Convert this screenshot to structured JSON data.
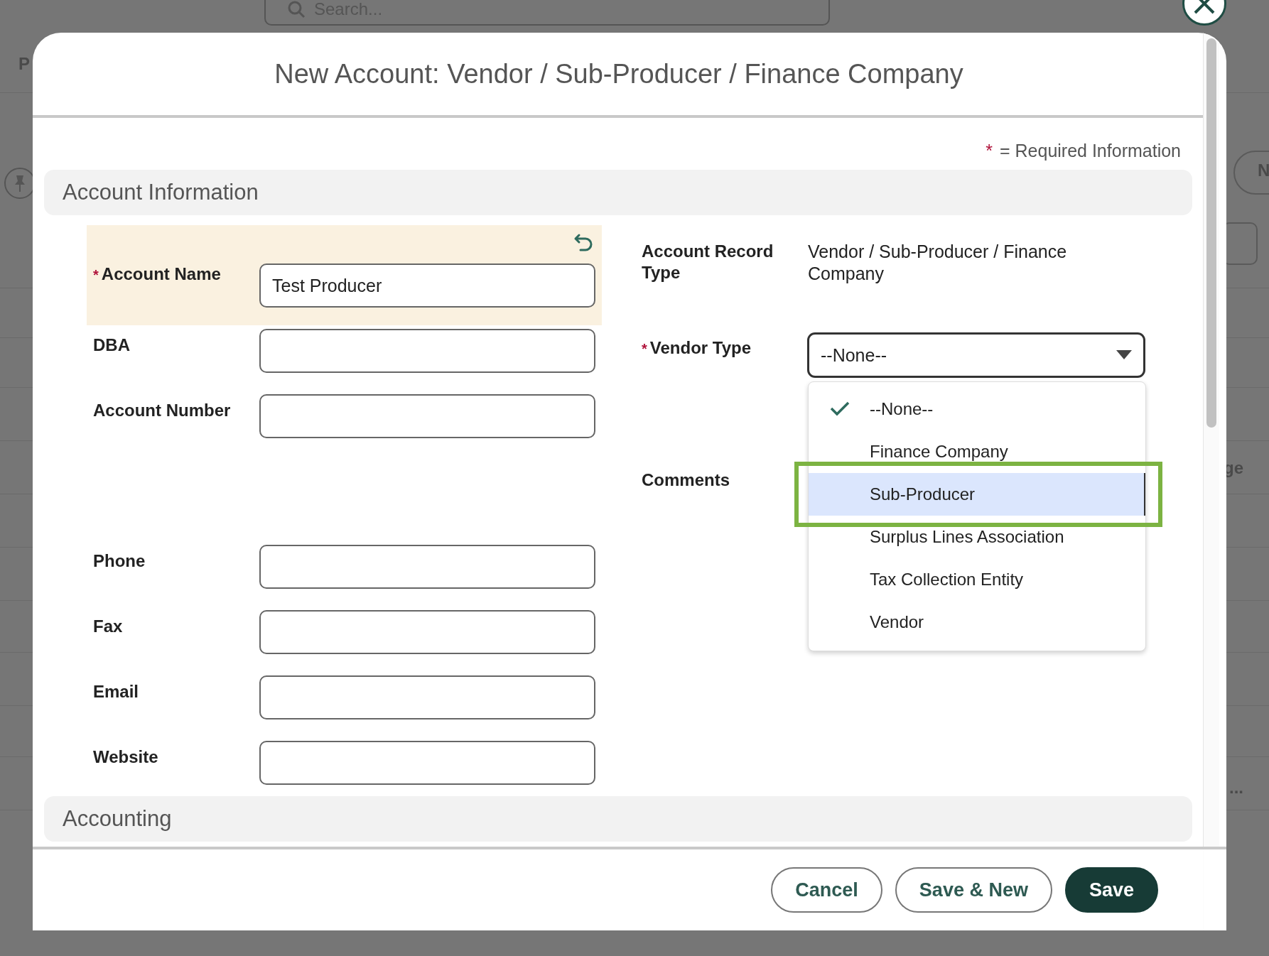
{
  "background": {
    "search": {
      "placeholder": "Search..."
    },
    "fragments": [
      "P",
      "N",
      "ge",
      "..."
    ]
  },
  "modal": {
    "title": "New Account: Vendor / Sub-Producer / Finance Company",
    "required_note": {
      "mark": "*",
      "text": "= Required Information"
    }
  },
  "account_information": {
    "title": "Account Information",
    "left_fields": [
      {
        "label": "Account Name",
        "required": true,
        "value": "Test Producer",
        "changed": true
      },
      {
        "label": "DBA",
        "changed": false
      },
      {
        "label": "Account Number",
        "changed": false
      },
      {
        "label": "Phone",
        "changed": false
      },
      {
        "label": "Fax",
        "changed": false
      },
      {
        "label": "Email",
        "changed": false
      },
      {
        "label": "Website",
        "changed": false
      }
    ],
    "right_fields": [
      {
        "kind": "text",
        "label": "Account Record Type",
        "value": "Vendor / Sub-Producer / Finance Company"
      },
      {
        "kind": "picklist",
        "label": "Vendor Type",
        "required": true,
        "value": "--None--",
        "expanded": true,
        "options": [
          {
            "label": "--None--",
            "selected": true,
            "hovered": false,
            "annotated": false
          },
          {
            "label": "Finance Company",
            "selected": false,
            "hovered": false,
            "annotated": false
          },
          {
            "label": "Sub-Producer",
            "selected": false,
            "hovered": true,
            "annotated": true
          },
          {
            "label": "Surplus Lines Association",
            "selected": false,
            "hovered": false,
            "annotated": false
          },
          {
            "label": "Tax Collection Entity",
            "selected": false,
            "hovered": false,
            "annotated": false
          },
          {
            "label": "Vendor",
            "selected": false,
            "hovered": false,
            "annotated": false
          }
        ]
      },
      {
        "kind": "text",
        "label": "Comments"
      }
    ]
  },
  "accounting": {
    "title": "Accounting"
  },
  "footer": {
    "buttons": [
      {
        "label": "Cancel",
        "kind": "secondary"
      },
      {
        "label": "Save & New",
        "kind": "secondary"
      },
      {
        "label": "Save",
        "kind": "primary"
      }
    ]
  }
}
